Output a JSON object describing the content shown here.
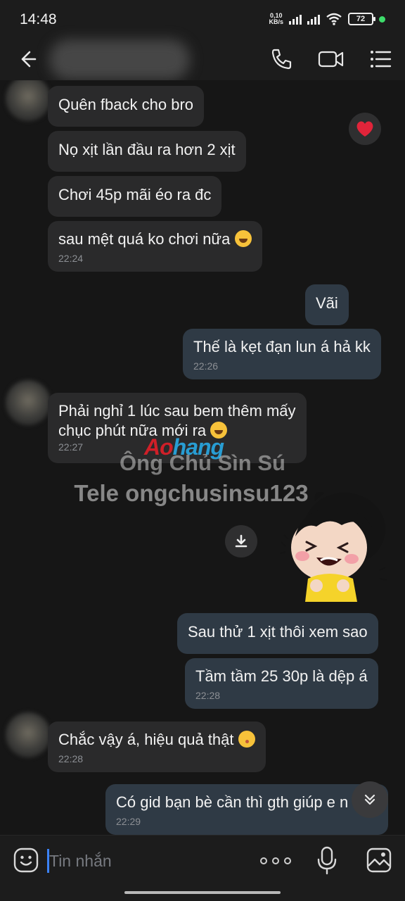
{
  "status_bar": {
    "time": "14:48",
    "net_speed_value": "0,10",
    "net_speed_unit": "KB/s",
    "battery": "72"
  },
  "header": {
    "back_icon": "arrow-left-icon",
    "call_icon": "phone-icon",
    "video_icon": "video-camera-icon",
    "menu_icon": "list-menu-icon"
  },
  "messages": [
    {
      "side": "in",
      "text": "Quên fback cho bro"
    },
    {
      "side": "in",
      "text": "Nọ xịt lần đầu ra hơn 2 xịt",
      "reaction": "heart"
    },
    {
      "side": "in",
      "text": "Chơi 45p mãi éo ra đc"
    },
    {
      "side": "in",
      "text": "sau mệt quá ko chơi nữa",
      "emoji": "laughing-tears",
      "time": "22:24"
    },
    {
      "side": "out",
      "text": "Vãi"
    },
    {
      "side": "out",
      "text": "Thế là kẹt đạn lun á hả kk",
      "time": "22:26"
    },
    {
      "side": "in",
      "text_line1": "Phải nghỉ 1 lúc sau bem thêm mấy",
      "text_line2": "chục phút nữa mới ra",
      "emoji": "laughing-tears",
      "time": "22:27"
    },
    {
      "side": "in",
      "type": "sticker",
      "sticker": "cartoon-girl-laughing"
    },
    {
      "side": "out",
      "text": "Sau thử 1 xịt thôi xem sao"
    },
    {
      "side": "out",
      "text": "Tầm tầm 25 30p là dệp á",
      "time": "22:28"
    },
    {
      "side": "in",
      "text": "Chắc vậy á, hiệu quả thật",
      "emoji": "kissing",
      "time": "22:28"
    },
    {
      "side": "out",
      "text": "Có gid bạn bè cần thì gth giúp e n",
      "time": "22:29"
    }
  ],
  "watermark": {
    "logo_part1": "Ao",
    "logo_part2": "hang",
    "line1": "Ông Chủ Sìn Sú",
    "line2": "Tele ongchusinsu123"
  },
  "composer": {
    "placeholder": "Tin nhắn",
    "sticker_icon": "smiley-sticker-icon",
    "more_icon": "more-dots-icon",
    "mic_icon": "microphone-icon",
    "image_icon": "image-gallery-icon"
  }
}
